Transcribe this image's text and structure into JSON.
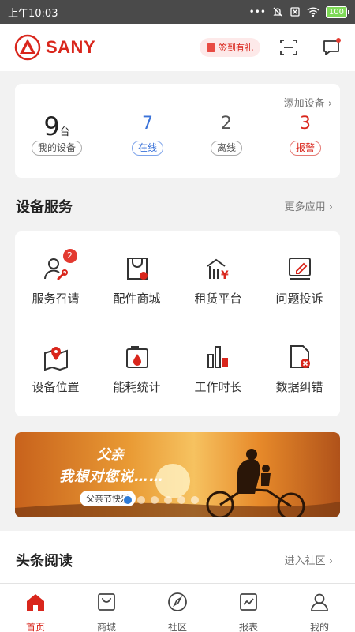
{
  "statusbar": {
    "time": "上午10:03",
    "battery": "100"
  },
  "header": {
    "brand": "SANY",
    "checkin_label": "签到有礼"
  },
  "devices": {
    "add_label": "添加设备",
    "mine": {
      "count": "9",
      "unit": "台",
      "label": "我的设备"
    },
    "online": {
      "count": "7",
      "label": "在线"
    },
    "offline": {
      "count": "2",
      "label": "离线"
    },
    "alarm": {
      "count": "3",
      "label": "报警"
    }
  },
  "services_section": {
    "title": "设备服务",
    "more": "更多应用"
  },
  "services": [
    {
      "label": "服务召请",
      "icon": "service-call-icon",
      "badge": "2"
    },
    {
      "label": "配件商城",
      "icon": "parts-shop-icon"
    },
    {
      "label": "租赁平台",
      "icon": "rental-icon"
    },
    {
      "label": "问题投诉",
      "icon": "complaint-icon"
    },
    {
      "label": "设备位置",
      "icon": "location-icon"
    },
    {
      "label": "能耗统计",
      "icon": "energy-icon"
    },
    {
      "label": "工作时长",
      "icon": "work-hours-icon"
    },
    {
      "label": "数据纠错",
      "icon": "data-correction-icon"
    }
  ],
  "banner": {
    "title": "父亲",
    "subtitle": "我想对您说……",
    "tag": "父亲节快乐"
  },
  "news_section": {
    "title": "头条阅读",
    "more": "进入社区"
  },
  "tabs": [
    {
      "label": "首页",
      "icon": "home-icon"
    },
    {
      "label": "商城",
      "icon": "shop-icon"
    },
    {
      "label": "社区",
      "icon": "compass-icon"
    },
    {
      "label": "报表",
      "icon": "report-icon"
    },
    {
      "label": "我的",
      "icon": "profile-icon"
    }
  ],
  "colors": {
    "brand_red": "#d9261c",
    "online_blue": "#3b73d9"
  }
}
